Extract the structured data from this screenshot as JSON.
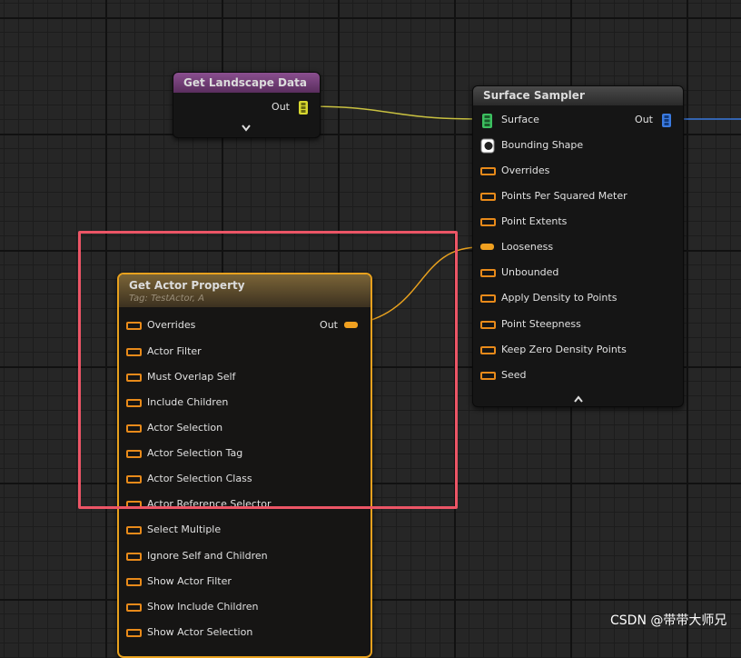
{
  "nodes": {
    "get_landscape_data": {
      "title": "Get Landscape Data",
      "out_label": "Out"
    },
    "surface_sampler": {
      "title": "Surface Sampler",
      "out_label": "Out",
      "inputs": [
        "Surface",
        "Bounding Shape",
        "Overrides",
        "Points Per Squared Meter",
        "Point Extents",
        "Looseness",
        "Unbounded",
        "Apply Density to Points",
        "Point Steepness",
        "Keep Zero Density Points",
        "Seed"
      ]
    },
    "get_actor_property": {
      "title": "Get Actor Property",
      "subtitle": "Tag: TestActor, A",
      "out_label": "Out",
      "inputs": [
        "Overrides",
        "Actor Filter",
        "Must Overlap Self",
        "Include Children",
        "Actor Selection",
        "Actor Selection Tag",
        "Actor Selection Class",
        "Actor Reference Selector",
        "Select Multiple",
        "Ignore Self and Children",
        "Show Actor Filter",
        "Show Include Children",
        "Show Actor Selection"
      ]
    }
  },
  "watermark": "CSDN @带带大师兄",
  "colors": {
    "landscape_header": "#8a4f8f",
    "sampler_header": "#3a3a3a",
    "actor_header": "#6e5a35",
    "actor_border": "#e8a11e",
    "override_pin": "#e88a1a",
    "surface_pin": "#3cc060",
    "landscape_pin": "#d8d830",
    "out_pin_blue": "#3a7ae0",
    "wire_yellow": "#c8c040",
    "wire_orange": "#e8a11e",
    "wire_blue": "#3a7ae0",
    "highlight_box": "#ec5566"
  }
}
